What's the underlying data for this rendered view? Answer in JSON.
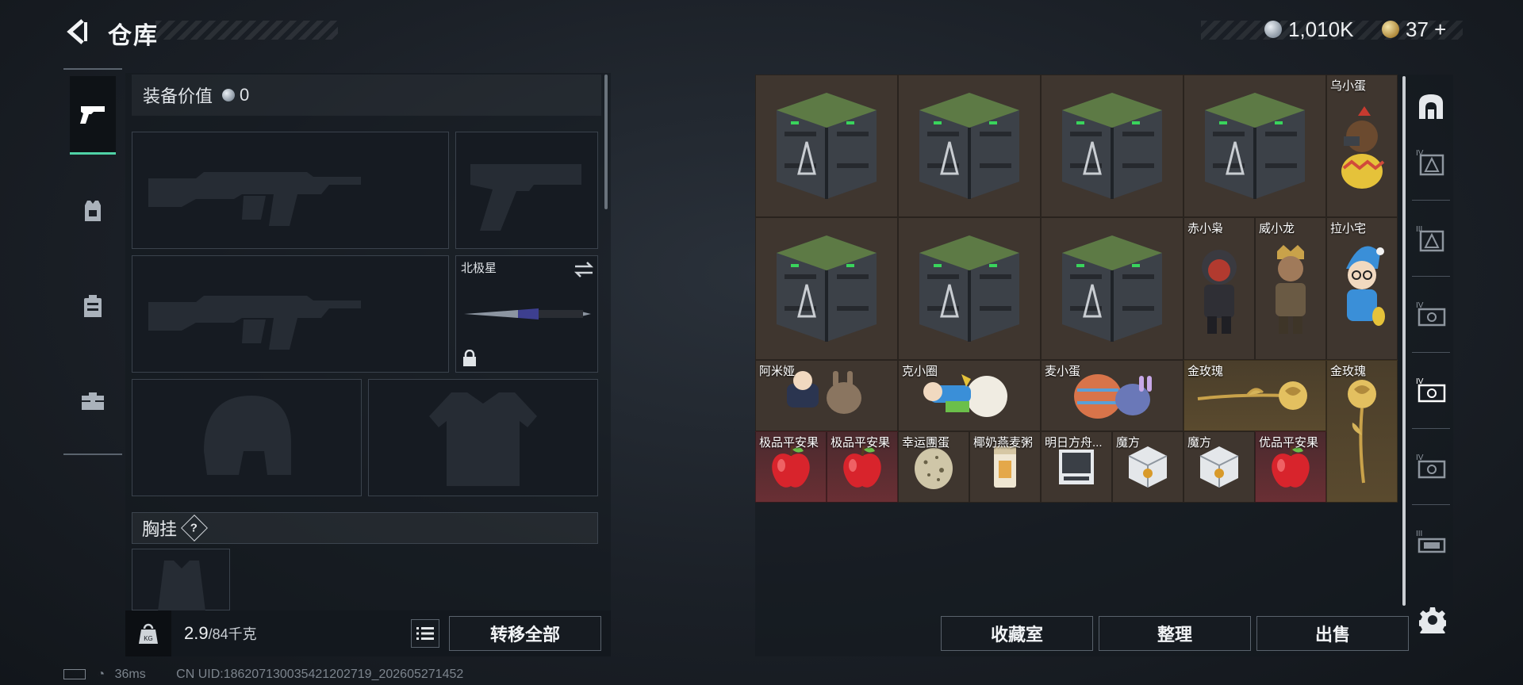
{
  "header": {
    "title": "仓库",
    "currency_silver": "1,010K",
    "currency_gold": "37 +"
  },
  "equipment": {
    "value_label": "装备价值",
    "value": "0",
    "melee_name": "北极星",
    "chest_rig_label": "胸挂",
    "chest_help": "?",
    "weight_current": "2.9",
    "weight_max": "/84千克",
    "transfer_all": "转移全部"
  },
  "stash": {
    "items": [
      {
        "label": ""
      },
      {
        "label": ""
      },
      {
        "label": ""
      },
      {
        "label": ""
      },
      {
        "label": "乌小蛋"
      },
      {
        "label": ""
      },
      {
        "label": ""
      },
      {
        "label": ""
      },
      {
        "label": "赤小枭"
      },
      {
        "label": "威小龙"
      },
      {
        "label": "拉小宅"
      },
      {
        "label": "阿米娅"
      },
      {
        "label": "克小圈"
      },
      {
        "label": "麦小蛋"
      },
      {
        "label": "金玫瑰"
      },
      {
        "label": "金玫瑰"
      },
      {
        "label": "极品平安果"
      },
      {
        "label": "极品平安果"
      },
      {
        "label": "幸运團蛋"
      },
      {
        "label": "椰奶燕麦粥"
      },
      {
        "label": "明日方舟..."
      },
      {
        "label": "魔方"
      },
      {
        "label": "魔方"
      },
      {
        "label": "优品平安果"
      }
    ],
    "collection_button": "收藏室",
    "sort_button": "整理",
    "sell_button": "出售"
  },
  "status_bar": {
    "ping": "36ms",
    "uid": "CN UID:18620713003542120271​9_202605271452"
  },
  "colors": {
    "accent": "#4fd2a6",
    "stash_bg": "#3a332d",
    "red_item": "#6a2f34",
    "gold_item": "#5a4a2e"
  }
}
